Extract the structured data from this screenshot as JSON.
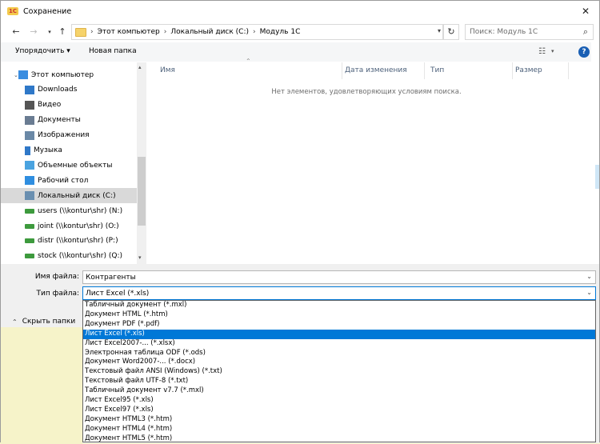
{
  "window": {
    "title": "Сохранение",
    "app_icon_text": "1С"
  },
  "nav": {
    "back_icon": "arrow-left-icon",
    "forward_icon": "arrow-right-icon",
    "recent_icon": "chevron-down-icon",
    "up_icon": "arrow-up-icon",
    "breadcrumbs": [
      "Этот компьютер",
      "Локальный диск (C:)",
      "Модуль 1С"
    ],
    "search_placeholder": "Поиск: Модуль 1С"
  },
  "toolbar": {
    "organize_label": "Упорядочить ▾",
    "new_folder_label": "Новая папка"
  },
  "sidebar": {
    "items": [
      {
        "label": "Этот компьютер",
        "icon": "computer-icon",
        "color": "#3a8de0"
      },
      {
        "label": "Downloads",
        "icon": "download-icon",
        "color": "#2f78c8"
      },
      {
        "label": "Видео",
        "icon": "video-icon",
        "color": "#555555"
      },
      {
        "label": "Документы",
        "icon": "document-icon",
        "color": "#6a7c92"
      },
      {
        "label": "Изображения",
        "icon": "image-icon",
        "color": "#6a88a6"
      },
      {
        "label": "Музыка",
        "icon": "music-icon",
        "color": "#2f78c8"
      },
      {
        "label": "Объемные объекты",
        "icon": "cube-icon",
        "color": "#4aa3e0"
      },
      {
        "label": "Рабочий стол",
        "icon": "desktop-icon",
        "color": "#2f8ee0"
      },
      {
        "label": "Локальный диск (C:)",
        "icon": "drive-icon",
        "color": "#6a8fb0",
        "selected": true
      },
      {
        "label": "users (\\\\kontur\\shr) (N:)",
        "icon": "network-drive-icon",
        "color": "#3d9a3d"
      },
      {
        "label": "joint (\\\\kontur\\shr) (O:)",
        "icon": "network-drive-icon",
        "color": "#3d9a3d"
      },
      {
        "label": "distr (\\\\kontur\\shr) (P:)",
        "icon": "network-drive-icon",
        "color": "#3d9a3d"
      },
      {
        "label": "stock (\\\\kontur\\shr) (Q:)",
        "icon": "network-drive-icon",
        "color": "#3d9a3d"
      }
    ]
  },
  "main": {
    "columns": [
      "Имя",
      "Дата изменения",
      "Тип",
      "Размер"
    ],
    "empty_message": "Нет элементов, удовлетворяющих условиям поиска."
  },
  "form": {
    "filename_label": "Имя файла:",
    "filename_value": "Контрагенты",
    "filetype_label": "Тип файла:",
    "filetype_value": "Лист Excel (*.xls)",
    "hide_folders_label": "Скрыть папки"
  },
  "filetype_options": [
    "Табличный документ (*.mxl)",
    "Документ HTML (*.htm)",
    "Документ PDF (*.pdf)",
    "Лист Excel (*.xls)",
    "Лист Excel2007-... (*.xlsx)",
    "Электронная таблица ODF (*.ods)",
    "Документ Word2007-... (*.docx)",
    "Текстовый файл ANSI (Windows) (*.txt)",
    "Текстовый файл UTF-8 (*.txt)",
    "Табличный документ v7.7 (*.mxl)",
    "Лист Excel95 (*.xls)",
    "Лист Excel97 (*.xls)",
    "Документ HTML3 (*.htm)",
    "Документ HTML4 (*.htm)",
    "Документ HTML5 (*.htm)"
  ],
  "selected_option_index": 3,
  "colors": {
    "accent": "#0078d7",
    "selection_gray": "#d9d9d9",
    "background_yellow": "#f6f3c9"
  }
}
